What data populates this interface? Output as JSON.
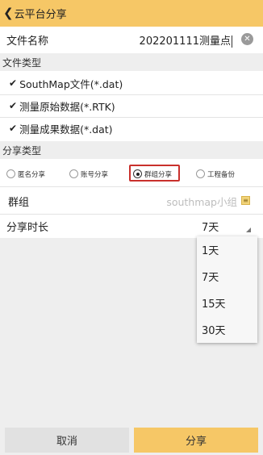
{
  "header": {
    "back_icon": "chevron-left-icon",
    "title": "云平台分享"
  },
  "file_name": {
    "label": "文件名称",
    "value": "202201111测量点",
    "clear_icon": "clear-circle-icon"
  },
  "file_type": {
    "section_title": "文件类型",
    "items": [
      {
        "label": "SouthMap文件(*.dat)",
        "checked": true
      },
      {
        "label": "测量原始数据(*.RTK)",
        "checked": true
      },
      {
        "label": "测量成果数据(*.dat)",
        "checked": true
      }
    ]
  },
  "share_type": {
    "section_title": "分享类型",
    "options": [
      {
        "label": "匿名分享",
        "selected": false
      },
      {
        "label": "账号分享",
        "selected": false
      },
      {
        "label": "群组分享",
        "selected": true
      },
      {
        "label": "工程备份",
        "selected": false
      }
    ],
    "highlight_color": "#c9302c"
  },
  "group": {
    "label": "群组",
    "value": "southmap小组",
    "icon": "group-pick-icon"
  },
  "duration": {
    "label": "分享时长",
    "value": "7天",
    "options": [
      "1天",
      "7天",
      "15天",
      "30天"
    ]
  },
  "actions": {
    "cancel": "取消",
    "share": "分享"
  },
  "colors": {
    "accent": "#f6c766"
  }
}
